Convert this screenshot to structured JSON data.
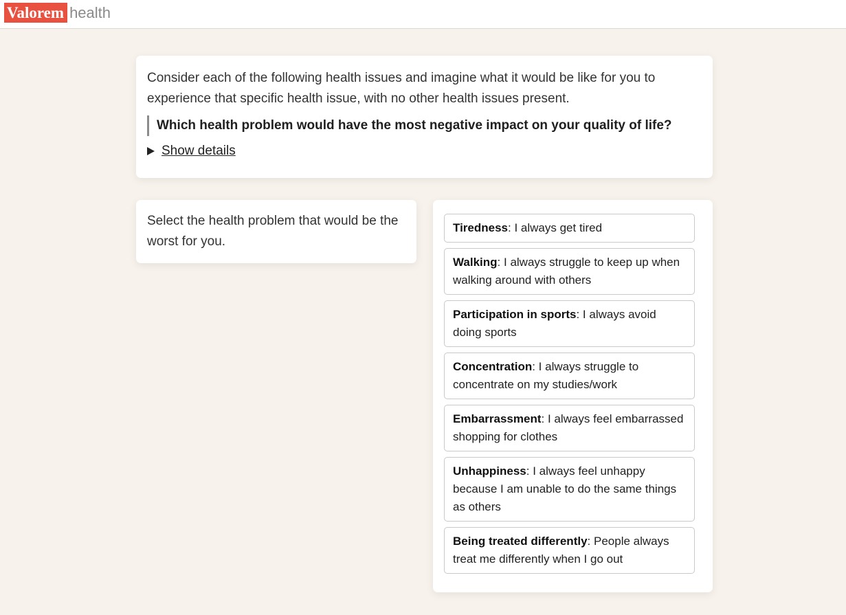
{
  "header": {
    "brand": "Valorem",
    "sub": "health"
  },
  "intro": {
    "text": "Consider each of the following health issues and imagine what it would be like for you to experience that specific health issue, with no other health issues present.",
    "question": "Which health problem would have the most negative impact on your quality of life?",
    "details_label": "Show details"
  },
  "instruction": {
    "text": "Select the health problem that would be the worst for you."
  },
  "options": [
    {
      "title": "Tiredness",
      "desc": ": I always get tired"
    },
    {
      "title": "Walking",
      "desc": ": I always struggle to keep up when walking around with others"
    },
    {
      "title": "Participation in sports",
      "desc": ": I always avoid doing sports"
    },
    {
      "title": "Concentration",
      "desc": ": I always struggle to concentrate on my studies/work"
    },
    {
      "title": "Embarrassment",
      "desc": ": I always feel embarrassed shopping for clothes"
    },
    {
      "title": "Unhappiness",
      "desc": ": I always feel unhappy because I am unable to do the same things as others"
    },
    {
      "title": "Being treated differently",
      "desc": ": People always treat me differently when I go out"
    }
  ],
  "colors": {
    "brand": "#e8503f",
    "background": "#f7f3ec"
  }
}
